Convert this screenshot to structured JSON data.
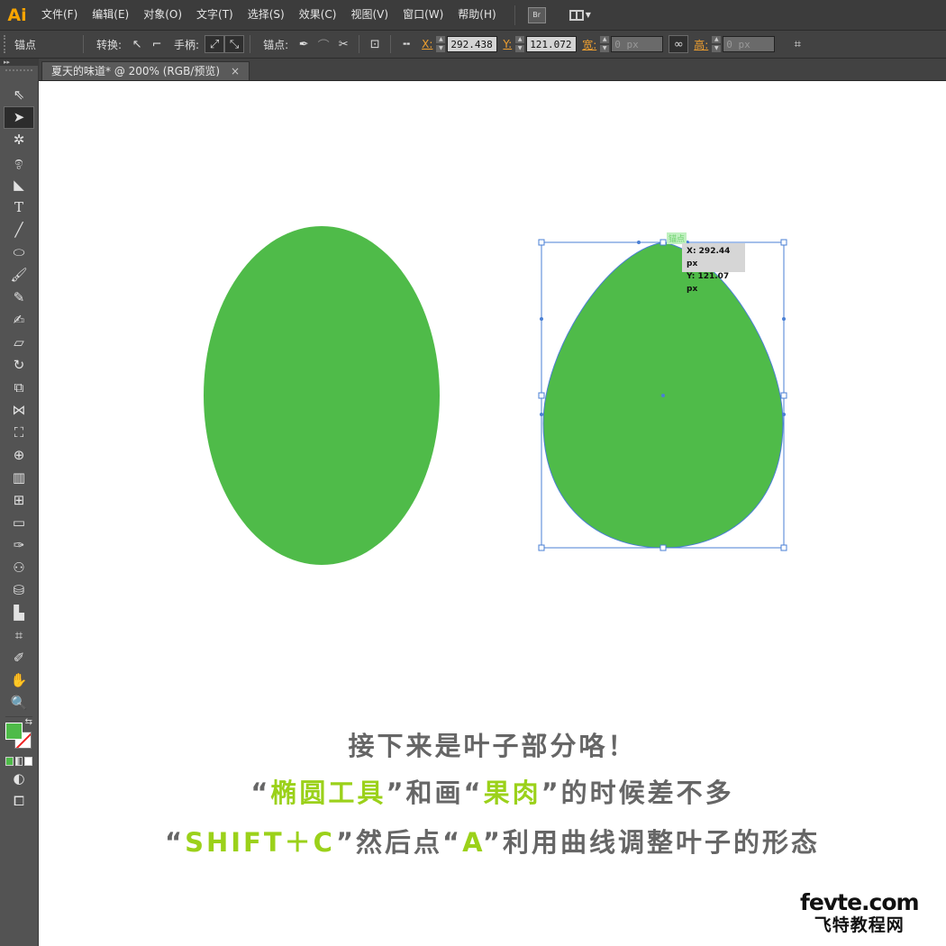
{
  "app": {
    "logo": "Ai"
  },
  "menu": [
    "文件(F)",
    "编辑(E)",
    "对象(O)",
    "文字(T)",
    "选择(S)",
    "效果(C)",
    "视图(V)",
    "窗口(W)",
    "帮助(H)"
  ],
  "menubar_buttons": {
    "bridge": "Br"
  },
  "control": {
    "title": "锚点",
    "convert_label": "转换:",
    "handles_label": "手柄:",
    "anchors_label": "锚点:",
    "x_label": "X:",
    "x_value": "292.438",
    "y_label": "Y:",
    "y_value": "121.072",
    "w_label": "宽:",
    "w_value": "0 px",
    "h_label": "高:",
    "h_value": "0 px"
  },
  "document": {
    "tab_title": "夏天的味道* @ 200% (RGB/预览)",
    "close": "×"
  },
  "colors": {
    "fill": "#4fbb49",
    "selection": "#4a7fd4",
    "accent_text": "#9bd11a"
  },
  "canvas": {
    "anchor_hint": "锚点",
    "tooltip_x": "X: 292.44 px",
    "tooltip_y": "Y: 121.07 px"
  },
  "caption": {
    "line1": "接下来是叶子部分咯！",
    "line2_open1": "“",
    "line2_hl1": "椭圆工具",
    "line2_mid": "”和画“",
    "line2_hl2": "果肉",
    "line2_end": "”的时候差不多",
    "line3_open": "“",
    "line3_hl1": "SHIFT＋C",
    "line3_mid": "”然后点“",
    "line3_hl2": "A",
    "line3_end": "”利用曲线调整叶子的形态"
  },
  "watermark": {
    "top": "fevte.com",
    "bottom": "飞特教程网"
  }
}
